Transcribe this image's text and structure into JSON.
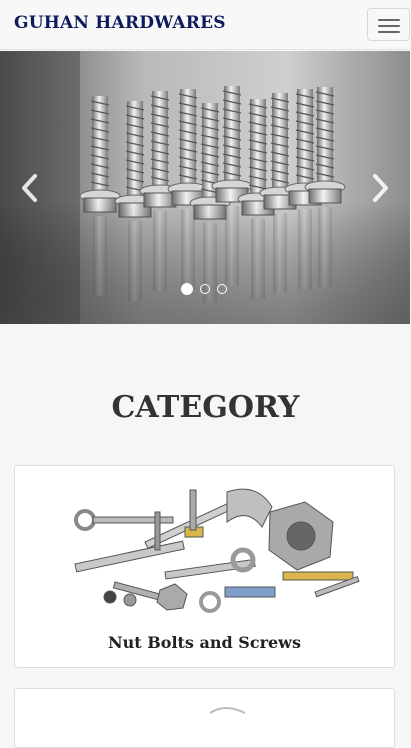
{
  "navbar": {
    "brand": "GUHAN HARDWARES",
    "menu_icon": "hamburger-menu-icon"
  },
  "carousel": {
    "prev_icon": "chevron-left-icon",
    "next_icon": "chevron-right-icon",
    "slide_count": 3,
    "active_slide": 1
  },
  "category": {
    "heading": "CATEGORY",
    "items": [
      {
        "title": "Nut Bolts and Screws"
      },
      {
        "title": ""
      }
    ]
  },
  "colors": {
    "brand": "#0d1b5c",
    "page_bg": "#f6f6f6",
    "navbar_bg": "#f8f8f8"
  }
}
